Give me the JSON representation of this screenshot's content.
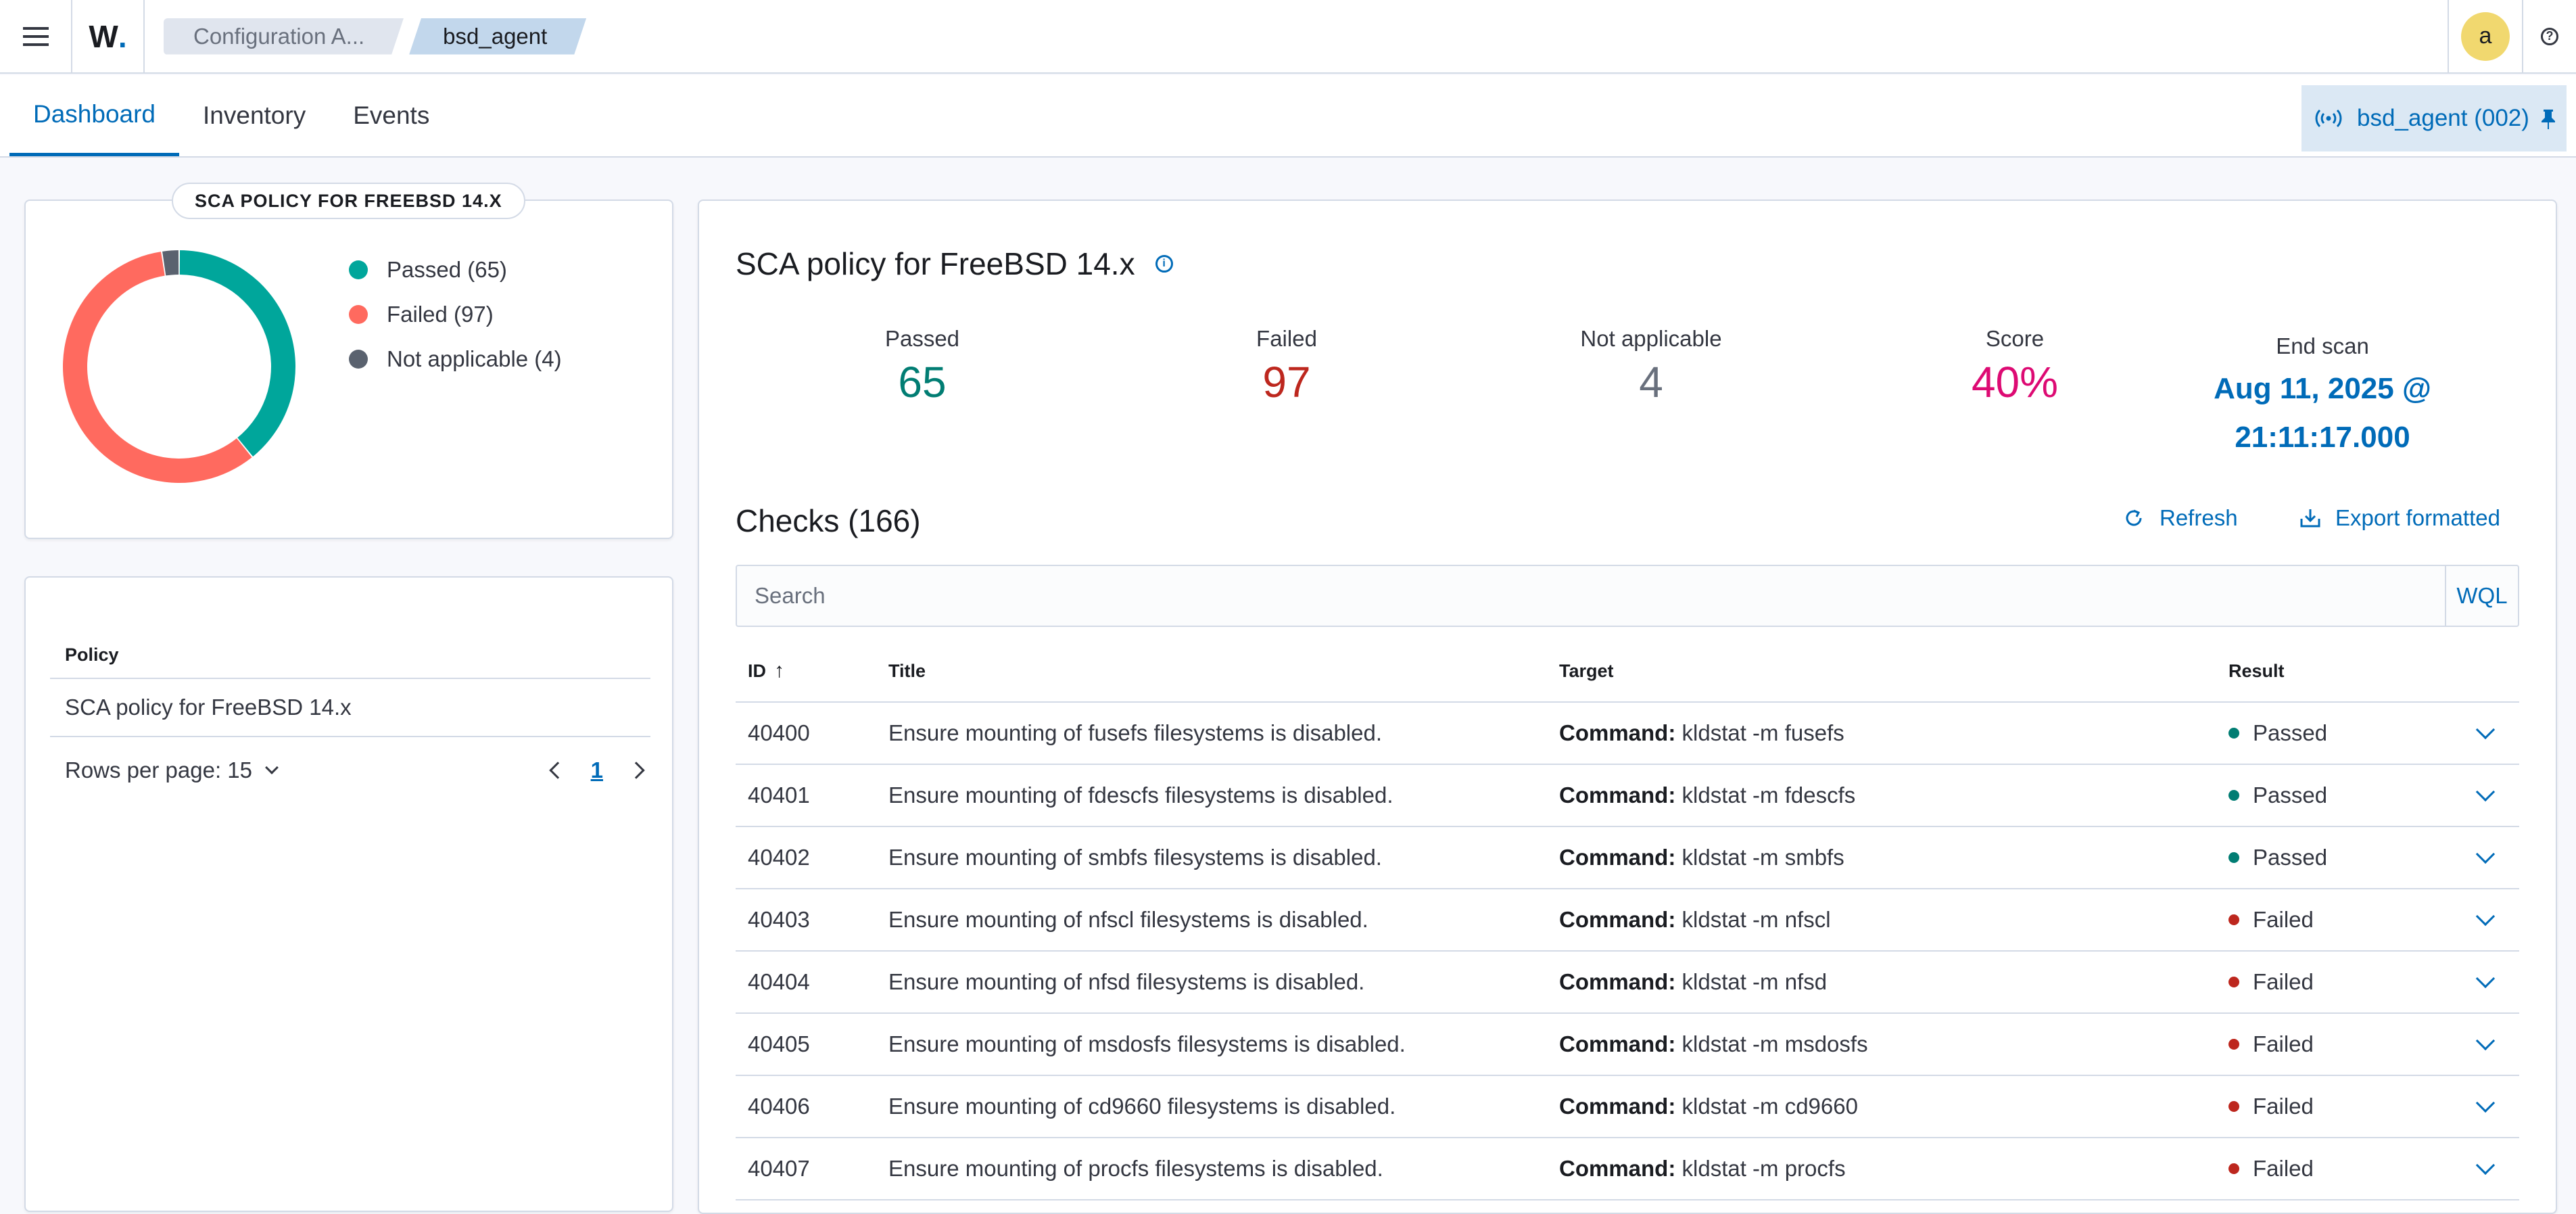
{
  "topbar": {
    "logo": "W",
    "breadcrumbs": [
      "Configuration A...",
      "bsd_agent"
    ],
    "avatar_initial": "a",
    "help_label": "?"
  },
  "tabs": [
    "Dashboard",
    "Inventory",
    "Events"
  ],
  "active_tab": "Dashboard",
  "agent_pill": "bsd_agent (002)",
  "summary_card": {
    "title": "SCA POLICY FOR FREEBSD 14.X",
    "legend": [
      {
        "label": "Passed (65)",
        "color": "#00a69b"
      },
      {
        "label": "Failed (97)",
        "color": "#ff6a5f"
      },
      {
        "label": "Not applicable (4)",
        "color": "#5a626f"
      }
    ]
  },
  "chart_data": {
    "type": "pie",
    "categories": [
      "Passed",
      "Failed",
      "Not applicable"
    ],
    "values": [
      65,
      97,
      4
    ],
    "colors": [
      "#00a69b",
      "#ff6a5f",
      "#5a626f"
    ],
    "title": "SCA POLICY FOR FREEBSD 14.X"
  },
  "policy_table": {
    "header": "Policy",
    "rows": [
      "SCA policy for FreeBSD 14.x"
    ],
    "rows_per_page": "Rows per page: 15",
    "current_page": "1"
  },
  "details": {
    "title": "SCA policy for FreeBSD 14.x",
    "stats": {
      "passed_label": "Passed",
      "passed_value": "65",
      "failed_label": "Failed",
      "failed_value": "97",
      "na_label": "Not applicable",
      "na_value": "4",
      "score_label": "Score",
      "score_value": "40%",
      "end_label": "End scan",
      "end_value_1": "Aug 11, 2025 @",
      "end_value_2": "21:11:17.000"
    },
    "colors": {
      "passed": "#017d73",
      "failed": "#bd271e",
      "na": "#69707d",
      "score": "#dd0a73",
      "link": "#006bb8"
    }
  },
  "checks": {
    "title": "Checks (166)",
    "refresh_label": "Refresh",
    "export_label": "Export formatted",
    "search_placeholder": "Search",
    "wql_label": "WQL",
    "columns": {
      "id": "ID",
      "title": "Title",
      "target": "Target",
      "result": "Result"
    },
    "rows": [
      {
        "id": "40400",
        "title": "Ensure mounting of fusefs filesystems is disabled.",
        "cmd_label": "Command:",
        "cmd": "kldstat -m fusefs",
        "result": "Passed"
      },
      {
        "id": "40401",
        "title": "Ensure mounting of fdescfs filesystems is disabled.",
        "cmd_label": "Command:",
        "cmd": "kldstat -m fdescfs",
        "result": "Passed"
      },
      {
        "id": "40402",
        "title": "Ensure mounting of smbfs filesystems is disabled.",
        "cmd_label": "Command:",
        "cmd": "kldstat -m smbfs",
        "result": "Passed"
      },
      {
        "id": "40403",
        "title": "Ensure mounting of nfscl filesystems is disabled.",
        "cmd_label": "Command:",
        "cmd": "kldstat -m nfscl",
        "result": "Failed"
      },
      {
        "id": "40404",
        "title": "Ensure mounting of nfsd filesystems is disabled.",
        "cmd_label": "Command:",
        "cmd": "kldstat -m nfsd",
        "result": "Failed"
      },
      {
        "id": "40405",
        "title": "Ensure mounting of msdosfs filesystems is disabled.",
        "cmd_label": "Command:",
        "cmd": "kldstat -m msdosfs",
        "result": "Failed"
      },
      {
        "id": "40406",
        "title": "Ensure mounting of cd9660 filesystems is disabled.",
        "cmd_label": "Command:",
        "cmd": "kldstat -m cd9660",
        "result": "Failed"
      },
      {
        "id": "40407",
        "title": "Ensure mounting of procfs filesystems is disabled.",
        "cmd_label": "Command:",
        "cmd": "kldstat -m procfs",
        "result": "Failed"
      }
    ],
    "result_colors": {
      "Passed": "#017d73",
      "Failed": "#bd271e"
    }
  }
}
